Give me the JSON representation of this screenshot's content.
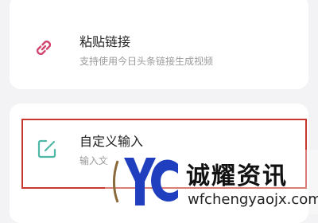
{
  "options": [
    {
      "icon": "link-icon",
      "title": "粘贴链接",
      "subtitle": "支持使用今日头条链接生成视频"
    },
    {
      "icon": "edit-icon",
      "title": "自定义输入",
      "subtitle": "输入文"
    }
  ],
  "watermark": {
    "logo": "yc-logo",
    "name": "诚耀资讯",
    "url": "wfchengyaojx.com"
  },
  "colors": {
    "link_icon": "#d0436d",
    "edit_icon": "#4eb7a5",
    "highlight_border": "#c8382f",
    "logo_blue": "#1f3fbf"
  }
}
